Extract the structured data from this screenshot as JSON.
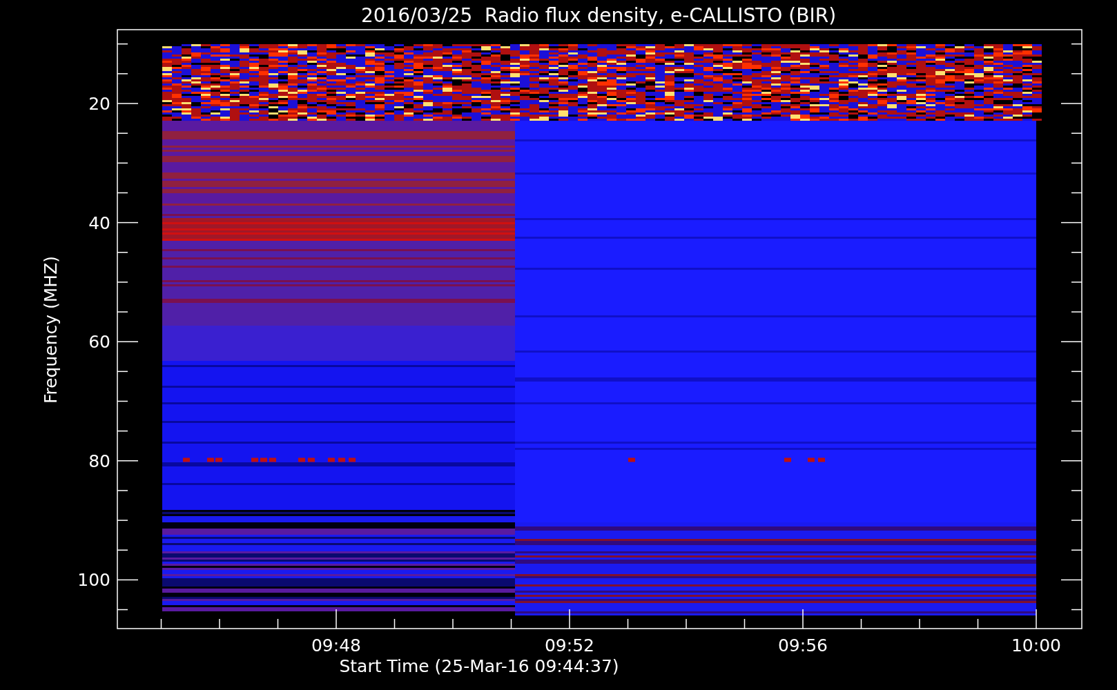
{
  "title": "2016/03/25  Radio flux density, e-CALLISTO (BIR)",
  "y_axis": {
    "label": "Frequency (MHZ)",
    "ticks": [
      "20",
      "40",
      "60",
      "80",
      "100"
    ]
  },
  "x_axis": {
    "label": "Start Time (25-Mar-16 09:44:37)",
    "ticks": [
      "09:48",
      "09:52",
      "09:56",
      "10:00"
    ]
  }
}
